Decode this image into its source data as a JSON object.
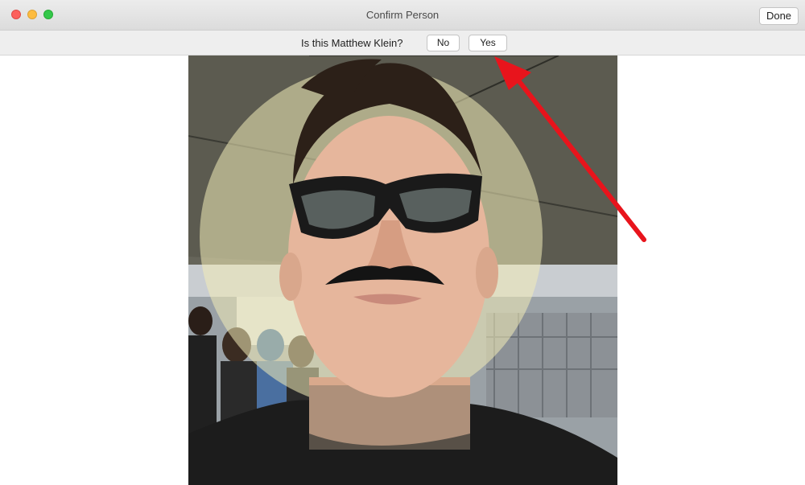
{
  "window": {
    "title": "Confirm Person",
    "done_label": "Done"
  },
  "confirm": {
    "question": "Is this Matthew Klein?",
    "no_label": "No",
    "yes_label": "Yes"
  },
  "colors": {
    "close": "#fc605c",
    "minimize": "#fdbc40",
    "maximize": "#34c84a",
    "annotation_arrow": "#e8141c"
  },
  "icons": {
    "close": "close-icon",
    "minimize": "minimize-icon",
    "maximize": "maximize-icon"
  }
}
